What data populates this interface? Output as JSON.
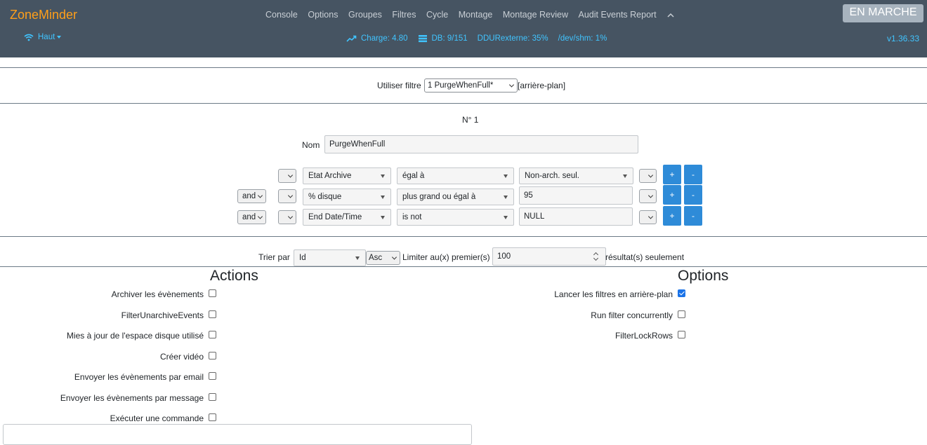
{
  "header": {
    "brand": "ZoneMinder",
    "nav": [
      "Console",
      "Options",
      "Groupes",
      "Filtres",
      "Cycle",
      "Montage",
      "Montage Review",
      "Audit Events Report"
    ],
    "collapse_icon": "chevron-up-icon",
    "run_state": "EN MARCHE",
    "bandwidth_label": "Haut",
    "load": "Charge: 4.80",
    "db": "DB: 9/151",
    "storage": "DDURexterne: 35%",
    "shm": "/dev/shm: 1%",
    "version": "v1.36.33",
    "colors": {
      "header_bg": "#465462",
      "brand": "#ff9f1a",
      "status": "#40c4ff"
    }
  },
  "filter_select": {
    "label": "Utiliser filtre",
    "selected": "1 PurgeWhenFull*",
    "suffix": "[arrière-plan]"
  },
  "filter": {
    "id_label": "N° 1",
    "name_label": "Nom",
    "name_value": "PurgeWhenFull",
    "rows": [
      {
        "conj": "",
        "attr": "Etat Archive",
        "op": "égal à",
        "value": "Non-arch. seul.",
        "value_type": "select"
      },
      {
        "conj": "and",
        "attr": "% disque",
        "op": "plus grand ou égal à",
        "value": "95",
        "value_type": "text"
      },
      {
        "conj": "and",
        "attr": "End Date/Time",
        "op": "is not",
        "value": "NULL",
        "value_type": "text"
      }
    ],
    "add_label": "+",
    "remove_label": "-"
  },
  "sort": {
    "label": "Trier par",
    "field": "Id",
    "direction": "Asc",
    "limit_label": "Limiter au(x) premier(s)",
    "limit_value": "100",
    "limit_suffix": "résultat(s) seulement"
  },
  "actions": {
    "title": "Actions",
    "items": [
      {
        "label": "Archiver les évènements",
        "checked": false
      },
      {
        "label": "FilterUnarchiveEvents",
        "checked": false
      },
      {
        "label": "Mies à jour de l'espace disque utilisé",
        "checked": false
      },
      {
        "label": "Créer vidéo",
        "checked": false
      },
      {
        "label": "Envoyer les évènements par email",
        "checked": false
      },
      {
        "label": "Envoyer les évènements par message",
        "checked": false
      },
      {
        "label": "Exécuter une commande",
        "checked": false
      }
    ]
  },
  "options": {
    "title": "Options",
    "items": [
      {
        "label": "Lancer les filtres en arrière-plan",
        "checked": true
      },
      {
        "label": "Run filter concurrently",
        "checked": false
      },
      {
        "label": "FilterLockRows",
        "checked": false
      }
    ]
  }
}
